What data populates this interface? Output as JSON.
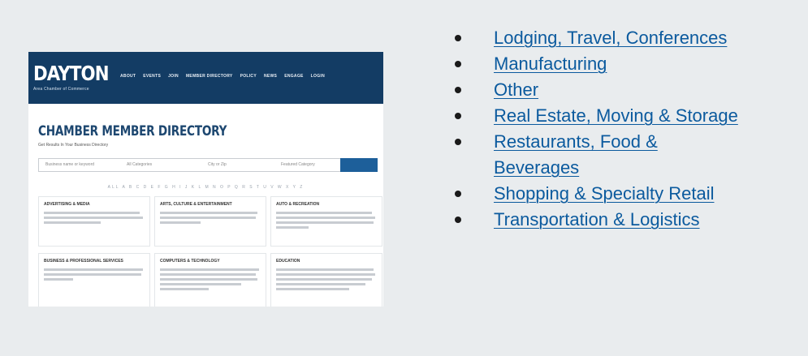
{
  "thumbnail": {
    "logo": "DAYTON",
    "logo_sub": "Area Chamber of Commerce",
    "nav": [
      "ABOUT",
      "EVENTS",
      "JOIN",
      "MEMBER DIRECTORY",
      "POLICY",
      "NEWS",
      "ENGAGE",
      "LOGIN"
    ],
    "title": "CHAMBER MEMBER DIRECTORY",
    "subtitle": "Get Results In Your Business Directory",
    "search": {
      "keyword": "Business name or keyword",
      "category": "All Categories",
      "location": "City or Zip",
      "filter": "Featured Category",
      "button": "SEARCH"
    },
    "alphabet": "ALL  A  B  C  D  E  F  G  H  I  J  K  L  M  N  O  P  Q  R  S  T  U  V  W  X  Y  Z",
    "cards": [
      "ADVERTISING & MEDIA",
      "ARTS, CULTURE & ENTERTAINMENT",
      "AUTO & RECREATION",
      "BUSINESS & PROFESSIONAL SERVICES",
      "COMPUTERS & TECHNOLOGY",
      "EDUCATION"
    ]
  },
  "list": {
    "items": [
      {
        "label": "Lodging, Travel, Conferences"
      },
      {
        "label": "Manufacturing"
      },
      {
        "label": "Other"
      },
      {
        "label": "Real Estate, Moving & Storage"
      },
      {
        "label": "Restaurants, Food &"
      },
      {
        "label": "Beverages"
      },
      {
        "label": "Shopping & Specialty Retail"
      },
      {
        "label": "Transportation & Logistics"
      }
    ]
  },
  "colors": {
    "panel_bg": "#e9ecee",
    "link": "#0b5a9e",
    "header_navy": "#133c64"
  }
}
